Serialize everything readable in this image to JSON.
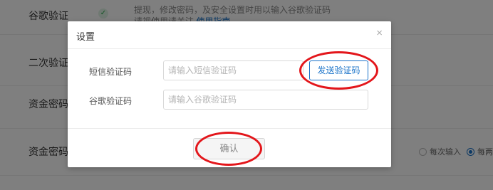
{
  "background": {
    "rows": [
      {
        "label": "谷歌验证",
        "desc_line1": "提现，修改密码，及安全设置时用以输入谷歌验证码",
        "desc_line2": "请视使用请关注",
        "desc_link": "使用指南"
      },
      {
        "label": "二次验证"
      },
      {
        "label": "资金密码"
      },
      {
        "label": "资金密码"
      }
    ],
    "radio_options": [
      "每次输入",
      "每两"
    ]
  },
  "dialog": {
    "title": "设置",
    "close_glyph": "×",
    "sms_label": "短信验证码",
    "sms_placeholder": "请输入短信验证码",
    "send_button": "发送验证码",
    "google_label": "谷歌验证码",
    "google_placeholder": "请输入谷歌验证码",
    "confirm_button": "确认"
  },
  "colors": {
    "accent": "#1a73c9",
    "annotation": "#e3161b",
    "overlay": "rgba(0,0,0,0.5)"
  }
}
